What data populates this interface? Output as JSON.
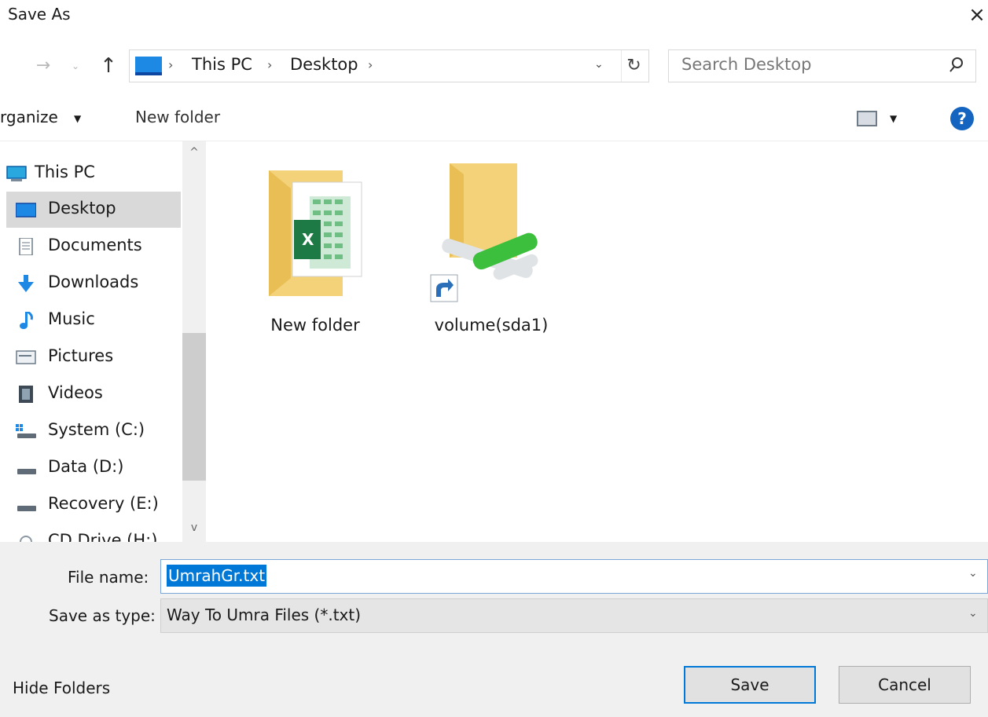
{
  "window": {
    "title": "Save As",
    "close_glyph": "×"
  },
  "nav": {
    "back_glyph": "→",
    "recent_glyph": "⌄",
    "up_glyph": "↑",
    "breadcrumbs": [
      "This PC",
      "Desktop"
    ],
    "separator_glyph": "›",
    "dropdown_glyph": "⌄",
    "refresh_glyph": "↻",
    "search_placeholder": "Search Desktop"
  },
  "toolbar": {
    "organize_label": "rganize",
    "caret_glyph": "▼",
    "new_folder_label": "New folder",
    "help_glyph": "?"
  },
  "sidebar": {
    "items": [
      {
        "label": "This PC",
        "icon": "this-pc-icon"
      },
      {
        "label": "Desktop",
        "icon": "desktop-icon",
        "selected": true
      },
      {
        "label": "Documents",
        "icon": "documents-icon"
      },
      {
        "label": "Downloads",
        "icon": "downloads-icon"
      },
      {
        "label": "Music",
        "icon": "music-icon"
      },
      {
        "label": "Pictures",
        "icon": "pictures-icon"
      },
      {
        "label": "Videos",
        "icon": "videos-icon"
      },
      {
        "label": "System (C:)",
        "icon": "system-drive-icon"
      },
      {
        "label": "Data (D:)",
        "icon": "drive-icon"
      },
      {
        "label": "Recovery (E:)",
        "icon": "drive-icon"
      },
      {
        "label": "CD Drive (H:)",
        "icon": "cd-drive-icon"
      }
    ],
    "scroll_up_glyph": "^",
    "scroll_down_glyph": "v"
  },
  "files": [
    {
      "name": "New folder",
      "icon": "folder-with-excel-icon"
    },
    {
      "name": "volume(sda1)",
      "icon": "network-share-shortcut-icon"
    }
  ],
  "form": {
    "file_name_label": "File name:",
    "file_name_value": "UmrahGr.txt",
    "save_type_label": "Save as type:",
    "save_type_value": "Way To Umra Files (*.txt)",
    "dropdown_glyph": "⌄"
  },
  "footer": {
    "hide_folders_label": "Hide Folders",
    "save_label": "Save",
    "cancel_label": "Cancel"
  },
  "colors": {
    "accent": "#0078d7",
    "selection_bg": "#d9d9d9",
    "panel_bg": "#f0f0f0",
    "help_blue": "#1565c0"
  }
}
